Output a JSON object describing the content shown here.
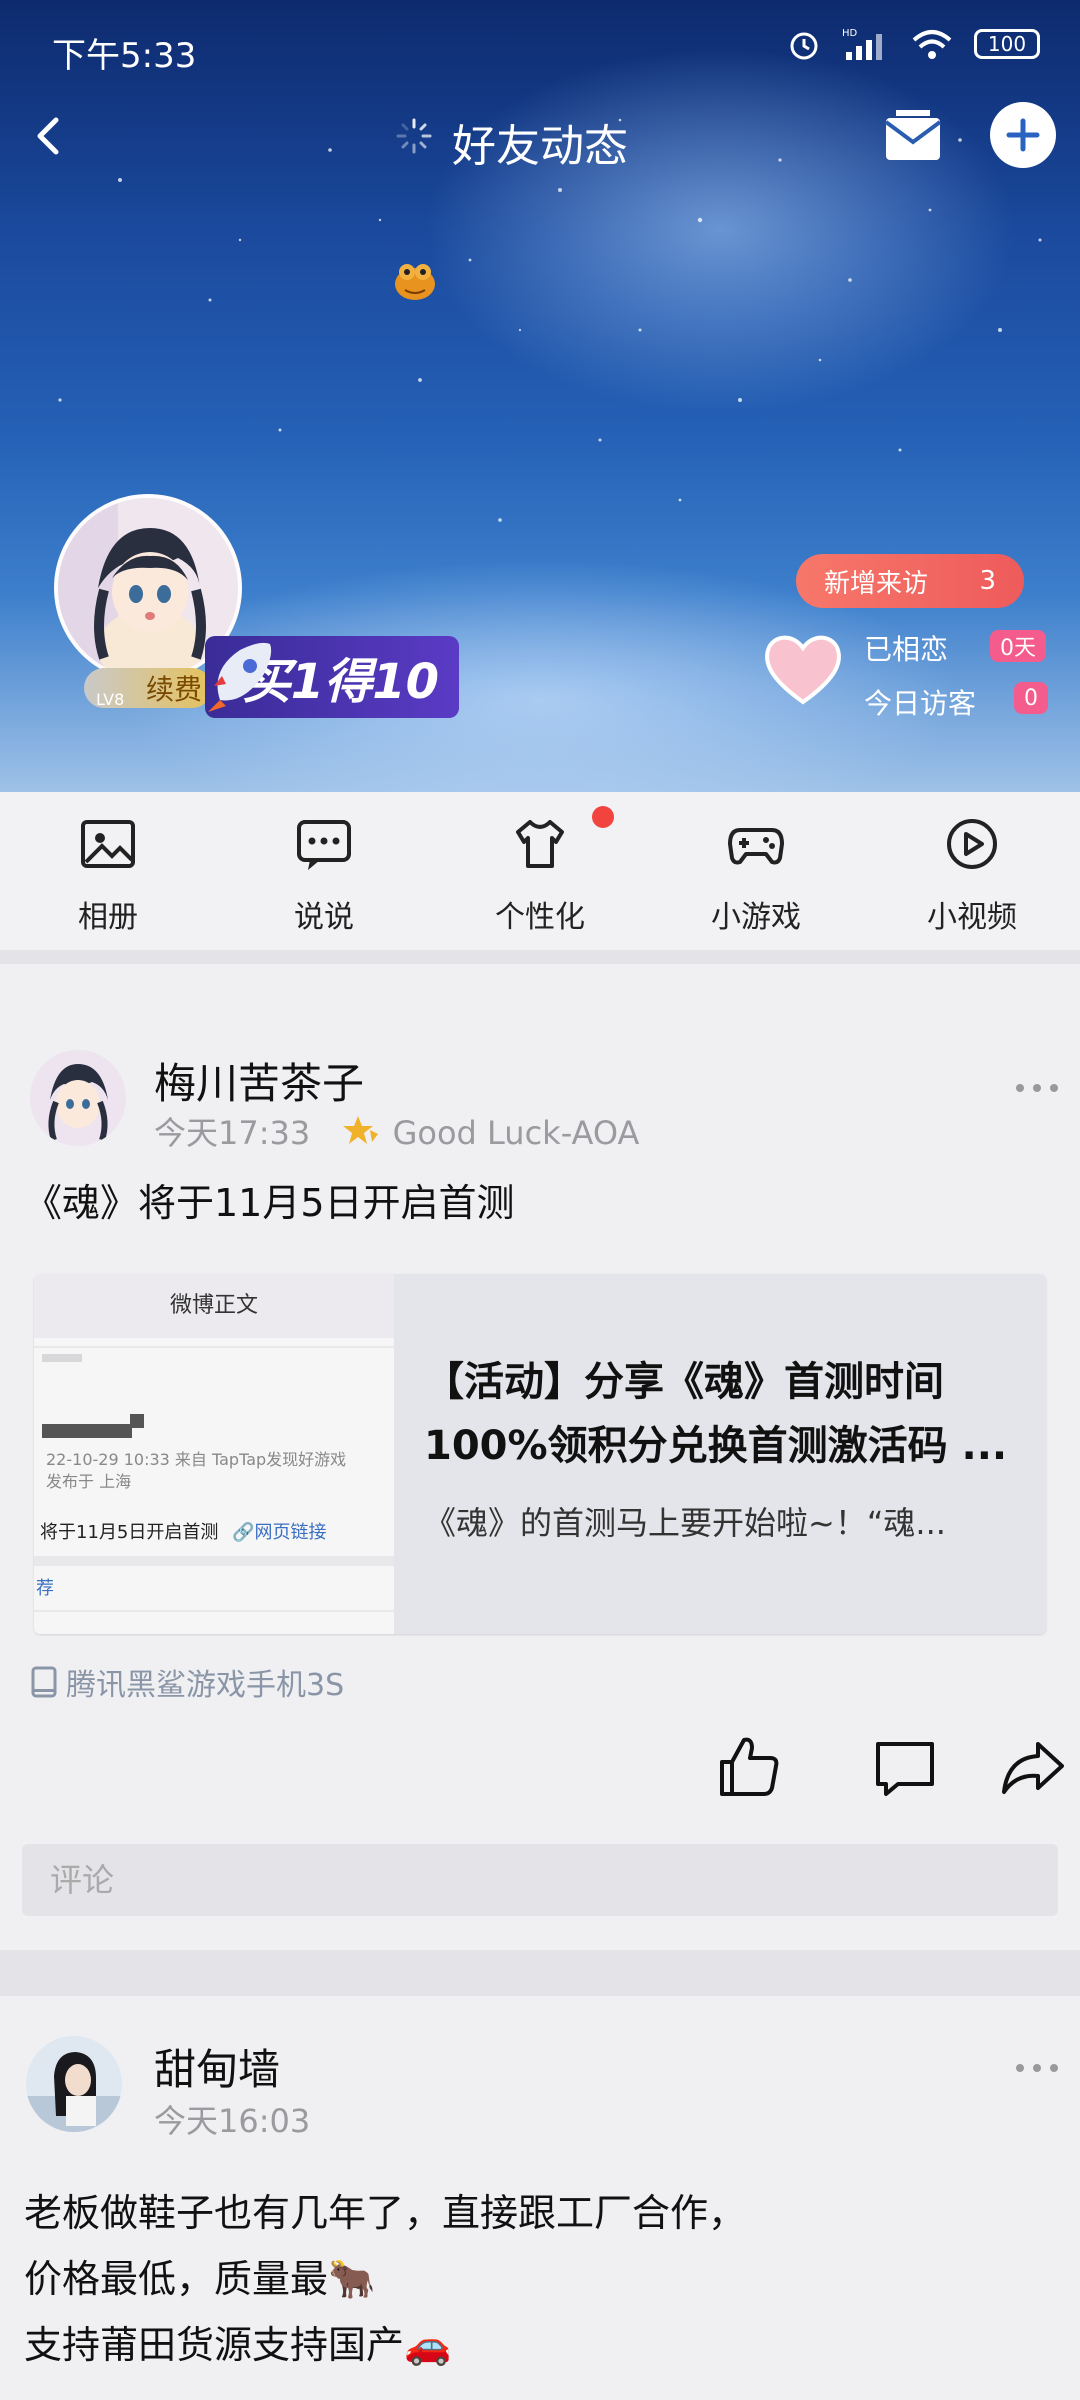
{
  "status_bar": {
    "time": "下午5:33",
    "battery": "100",
    "network_label": "HD"
  },
  "nav": {
    "title": "好友动态"
  },
  "profile": {
    "renew_label": "续费",
    "level_label": "LV8",
    "promo_label": "买1得10",
    "visits_label": "新增来访",
    "visits_count": "3",
    "love_label": "已相恋",
    "love_days": "0天",
    "visitors_label": "今日访客",
    "visitors_count": "0"
  },
  "quick_bar": [
    {
      "label": "相册",
      "icon": "photo-icon"
    },
    {
      "label": "说说",
      "icon": "chat-icon"
    },
    {
      "label": "个性化",
      "icon": "shirt-icon"
    },
    {
      "label": "小游戏",
      "icon": "gamepad-icon"
    },
    {
      "label": "小视频",
      "icon": "play-icon"
    }
  ],
  "posts": [
    {
      "author": "梅川苦茶子",
      "time": "今天17:33",
      "badge_text": "Good Luck-AOA",
      "text": "《魂》将于11月5日开启首测",
      "link_card": {
        "thumb_header": "微博正文",
        "thumb_line1": "22-10-29 10:33  来自 TapTap发现好游戏",
        "thumb_line2": "发布于 上海",
        "thumb_line3": "将于11月5日开启首测",
        "thumb_link": "网页链接",
        "thumb_tag": "荐",
        "title": "【活动】分享《魂》首测时间100%领积分兑换首测激活码 ...",
        "desc": "《魂》的首测马上要开始啦~！“魂..."
      },
      "device": "腾讯黑鲨游戏手机3S",
      "comment_placeholder": "评论"
    },
    {
      "author": "甜甸墙",
      "time": "今天16:03",
      "lines": [
        "老板做鞋子也有几年了，直接跟工厂合作，",
        "价格最低，质量最🐂",
        "支持莆田货源支持国产🚗"
      ]
    }
  ],
  "colors": {
    "accent_red": "#f2443f",
    "pink": "#f45c8d",
    "visits": "#ee5b5b"
  }
}
